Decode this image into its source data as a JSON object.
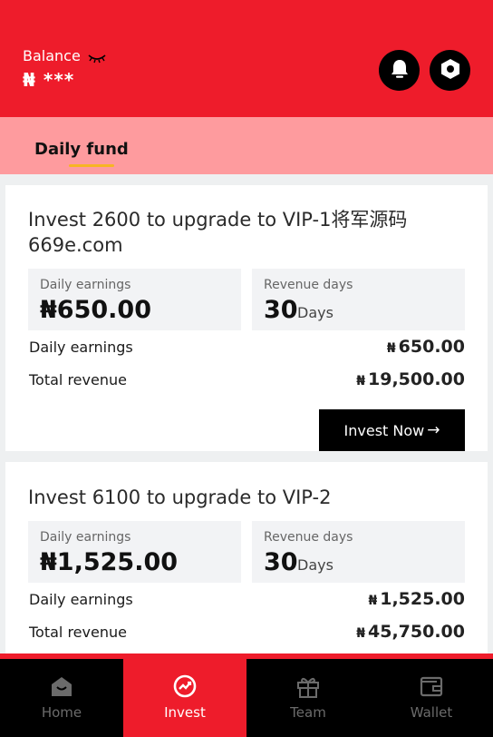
{
  "header": {
    "balance_label": "Balance",
    "balance_value": "₦ ***",
    "icons": [
      "eye-closed-icon",
      "bell-icon",
      "settings-hex-icon"
    ]
  },
  "tabs": [
    {
      "label": "Daily fund",
      "active": true
    }
  ],
  "cards": [
    {
      "title": "Invest 2600 to upgrade to VIP-1将军源码669e.com",
      "daily_box_label": "Daily earnings",
      "daily_box_value": "₦650.00",
      "days_box_label": "Revenue days",
      "days_value": "30",
      "days_unit": "Days",
      "daily_row_label": "Daily earnings",
      "daily_row_currency": "₦",
      "daily_row_value": "650.00",
      "total_row_label": "Total revenue",
      "total_row_currency": "₦",
      "total_row_value": "19,500.00",
      "button_label": "Invest Now"
    },
    {
      "title": "Invest 6100 to upgrade to VIP-2",
      "daily_box_label": "Daily earnings",
      "daily_box_value": "₦1,525.00",
      "days_box_label": "Revenue days",
      "days_value": "30",
      "days_unit": "Days",
      "daily_row_label": "Daily earnings",
      "daily_row_currency": "₦",
      "daily_row_value": "1,525.00",
      "total_row_label": "Total revenue",
      "total_row_currency": "₦",
      "total_row_value": "45,750.00"
    }
  ],
  "nav": [
    {
      "label": "Home",
      "icon": "home-icon",
      "active": false
    },
    {
      "label": "Invest",
      "icon": "trend-icon",
      "active": true
    },
    {
      "label": "Team",
      "icon": "gift-icon",
      "active": false
    },
    {
      "label": "Wallet",
      "icon": "wallet-icon",
      "active": false
    }
  ],
  "colors": {
    "brand_red": "#ee1c2b",
    "tab_bg": "#fe9b9e",
    "tab_underline": "#f7b523",
    "nav_bg": "#000000"
  }
}
